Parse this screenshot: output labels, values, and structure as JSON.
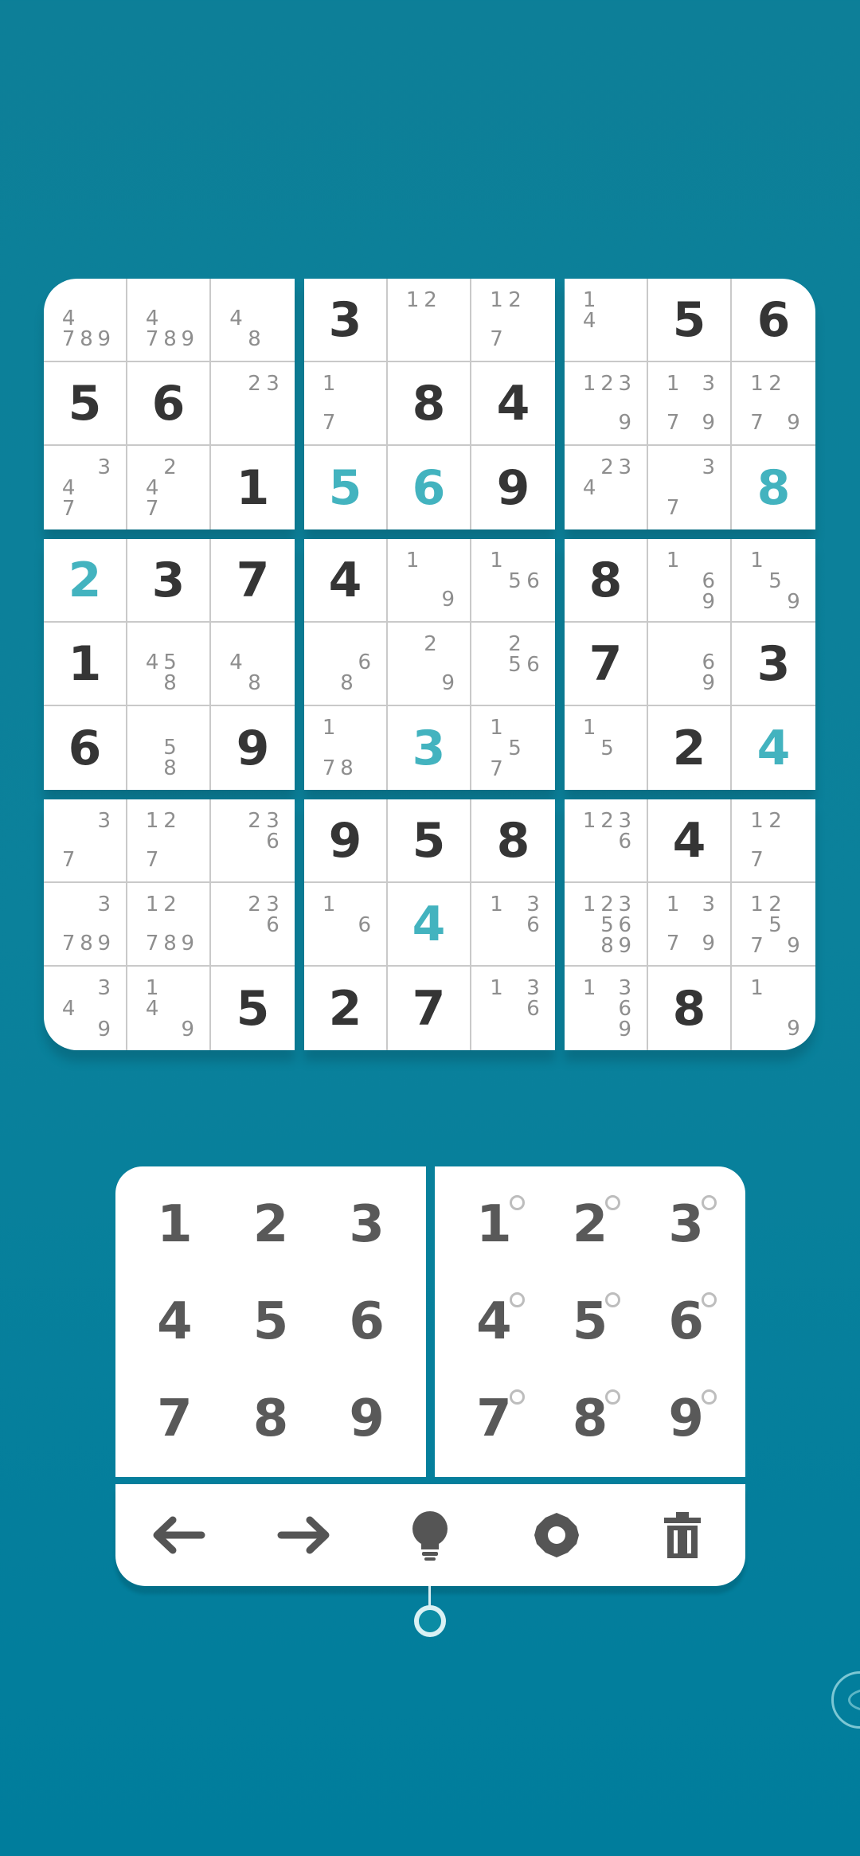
{
  "board": {
    "boxes": [
      [
        {
          "notes": "4789"
        },
        {
          "notes": "4789"
        },
        {
          "notes": "48"
        },
        {
          "value": "5"
        },
        {
          "value": "6"
        },
        {
          "notes": "23"
        },
        {
          "notes": "347"
        },
        {
          "notes": "247"
        },
        {
          "value": "1"
        }
      ],
      [
        {
          "value": "3"
        },
        {
          "notes": "12"
        },
        {
          "notes": "127"
        },
        {
          "notes": "17"
        },
        {
          "value": "8"
        },
        {
          "value": "4"
        },
        {
          "value": "5",
          "user": true
        },
        {
          "value": "6",
          "user": true
        },
        {
          "value": "9"
        }
      ],
      [
        {
          "notes": "14"
        },
        {
          "value": "5"
        },
        {
          "value": "6"
        },
        {
          "notes": "1239"
        },
        {
          "notes": "1379"
        },
        {
          "notes": "1279"
        },
        {
          "notes": "234"
        },
        {
          "notes": "37"
        },
        {
          "value": "8",
          "user": true
        }
      ],
      [
        {
          "value": "2",
          "user": true
        },
        {
          "value": "3"
        },
        {
          "value": "7"
        },
        {
          "value": "1"
        },
        {
          "notes": "458"
        },
        {
          "notes": "48"
        },
        {
          "value": "6"
        },
        {
          "notes": "58"
        },
        {
          "value": "9"
        }
      ],
      [
        {
          "value": "4"
        },
        {
          "notes": "19"
        },
        {
          "notes": "156"
        },
        {
          "notes": "68"
        },
        {
          "notes": "29"
        },
        {
          "notes": "256"
        },
        {
          "notes": "178"
        },
        {
          "value": "3",
          "user": true
        },
        {
          "notes": "157"
        }
      ],
      [
        {
          "value": "8"
        },
        {
          "notes": "169"
        },
        {
          "notes": "159"
        },
        {
          "value": "7"
        },
        {
          "notes": "69"
        },
        {
          "value": "3"
        },
        {
          "notes": "15"
        },
        {
          "value": "2"
        },
        {
          "value": "4",
          "user": true
        }
      ],
      [
        {
          "notes": "37"
        },
        {
          "notes": "127"
        },
        {
          "notes": "236"
        },
        {
          "notes": "3789"
        },
        {
          "notes": "12789"
        },
        {
          "notes": "236"
        },
        {
          "notes": "349"
        },
        {
          "notes": "149"
        },
        {
          "value": "5"
        }
      ],
      [
        {
          "value": "9"
        },
        {
          "value": "5"
        },
        {
          "value": "8"
        },
        {
          "notes": "16"
        },
        {
          "value": "4",
          "user": true
        },
        {
          "notes": "136"
        },
        {
          "value": "2"
        },
        {
          "value": "7"
        },
        {
          "notes": "136"
        }
      ],
      [
        {
          "notes": "1236"
        },
        {
          "value": "4"
        },
        {
          "notes": "127"
        },
        {
          "notes": "1235689"
        },
        {
          "notes": "1379"
        },
        {
          "notes": "12579"
        },
        {
          "notes": "1369"
        },
        {
          "value": "8"
        },
        {
          "notes": "19"
        }
      ]
    ]
  },
  "pads": {
    "digits": [
      "1",
      "2",
      "3",
      "4",
      "5",
      "6",
      "7",
      "8",
      "9"
    ],
    "notes": [
      "1",
      "2",
      "3",
      "4",
      "5",
      "6",
      "7",
      "8",
      "9"
    ]
  },
  "toolbar": {
    "items": [
      {
        "name": "arrow-left-icon"
      },
      {
        "name": "arrow-right-icon"
      },
      {
        "name": "lightbulb-icon"
      },
      {
        "name": "gear-icon"
      },
      {
        "name": "trash-icon"
      }
    ]
  },
  "colors": {
    "background": "#0b819b",
    "user_digit": "#43b3bf",
    "given_digit": "#353535",
    "note_digit": "#8e8e8e"
  }
}
